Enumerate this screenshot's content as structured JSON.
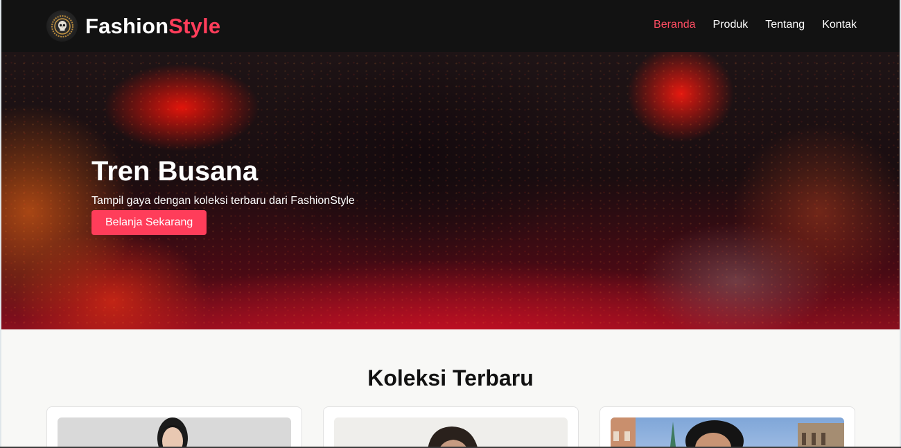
{
  "navbar": {
    "brand_main": "Fashion",
    "brand_accent": "Style",
    "links": [
      {
        "label": "Beranda",
        "active": true
      },
      {
        "label": "Produk",
        "active": false
      },
      {
        "label": "Tentang",
        "active": false
      },
      {
        "label": "Kontak",
        "active": false
      }
    ]
  },
  "hero": {
    "title": "Tren Busana",
    "subtitle": "Tampil gaya dengan koleksi terbaru dari FashionStyle",
    "button_label": "Belanja Sekarang"
  },
  "collection": {
    "title": "Koleksi Terbaru"
  },
  "colors": {
    "accent": "#ff3d5a",
    "navbar_bg": "#121212",
    "page_bg": "#f8f8f6"
  },
  "icons": {
    "logo": "skull-emblem-icon"
  }
}
